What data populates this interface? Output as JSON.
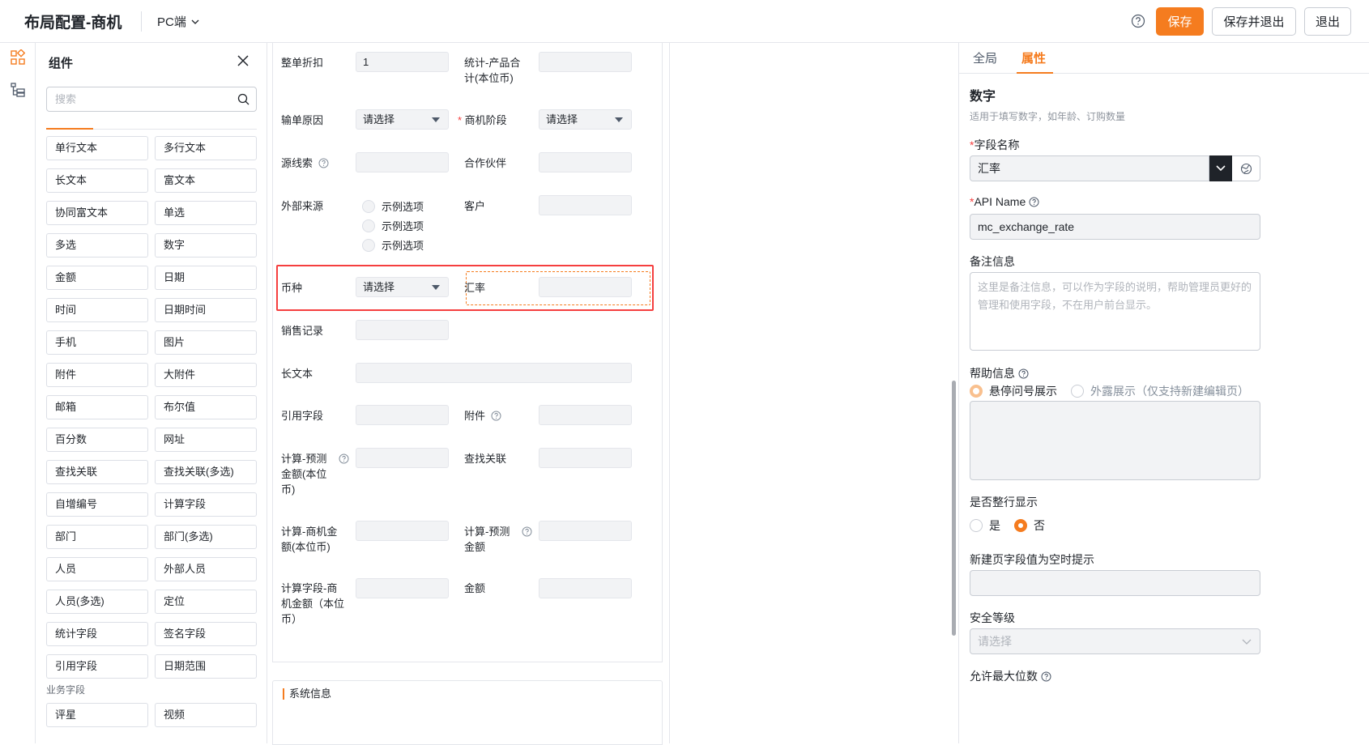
{
  "header": {
    "title": "布局配置-商机",
    "platform": "PC端",
    "save": "保存",
    "save_exit": "保存并退出",
    "exit": "退出"
  },
  "components": {
    "title": "组件",
    "search_placeholder": "搜索",
    "items": [
      "单行文本",
      "多行文本",
      "长文本",
      "富文本",
      "协同富文本",
      "单选",
      "多选",
      "数字",
      "金额",
      "日期",
      "时间",
      "日期时间",
      "手机",
      "图片",
      "附件",
      "大附件",
      "邮箱",
      "布尔值",
      "百分数",
      "网址",
      "查找关联",
      "查找关联(多选)",
      "自增编号",
      "计算字段",
      "部门",
      "部门(多选)",
      "人员",
      "外部人员",
      "人员(多选)",
      "定位",
      "统计字段",
      "签名字段",
      "引用字段",
      "日期范围"
    ],
    "section_business": "业务字段",
    "business_items": [
      "评星",
      "视频"
    ]
  },
  "form": {
    "r1": {
      "l1": "整单折扣",
      "v1": "1",
      "l2a": "统计-产品合",
      "l2b": "计(本位币)"
    },
    "r2": {
      "l1": "输单原因",
      "s1": "请选择",
      "l2": "商机阶段",
      "s2": "请选择"
    },
    "r3": {
      "l1": "源线索",
      "l2": "合作伙伴"
    },
    "r4": {
      "l1": "外部来源",
      "options": [
        "示例选项",
        "示例选项",
        "示例选项"
      ],
      "l2": "客户"
    },
    "r5": {
      "l1": "币种",
      "s1": "请选择",
      "l2": "汇率"
    },
    "r6": {
      "l1": "销售记录"
    },
    "r7": {
      "l1": "长文本"
    },
    "r8": {
      "l1": "引用字段",
      "l2": "附件"
    },
    "r9": {
      "l1a": "计算-预测",
      "l1b": "金额(本位",
      "l1c": "币)",
      "l2": "查找关联"
    },
    "r10": {
      "l1a": "计算-商机金",
      "l1b": "额(本位币)",
      "l2a": "计算-预测",
      "l2b": "金额"
    },
    "r11": {
      "l1a": "计算字段-商",
      "l1b": "机金额（本位",
      "l1c": "币）",
      "l2": "金额"
    },
    "system_section": "系统信息"
  },
  "props": {
    "tab_global": "全局",
    "tab_attr": "属性",
    "heading": "数字",
    "desc": "适用于填写数字，如年龄、订购数量",
    "field_name_label": "字段名称",
    "field_name_value": "汇率",
    "api_label": "API Name",
    "api_value": "mc_exchange_rate",
    "remark_label": "备注信息",
    "remark_placeholder": "这里是备注信息，可以作为字段的说明，帮助管理员更好的管理和使用字段，不在用户前台显示。",
    "help_label": "帮助信息",
    "help_opt1": "悬停问号展示",
    "help_opt2": "外露展示（仅支持新建编辑页）",
    "fullrow_label": "是否整行显示",
    "yes": "是",
    "no": "否",
    "empty_hint_label": "新建页字段值为空时提示",
    "security_label": "安全等级",
    "security_placeholder": "请选择",
    "maxdigits_label": "允许最大位数"
  }
}
